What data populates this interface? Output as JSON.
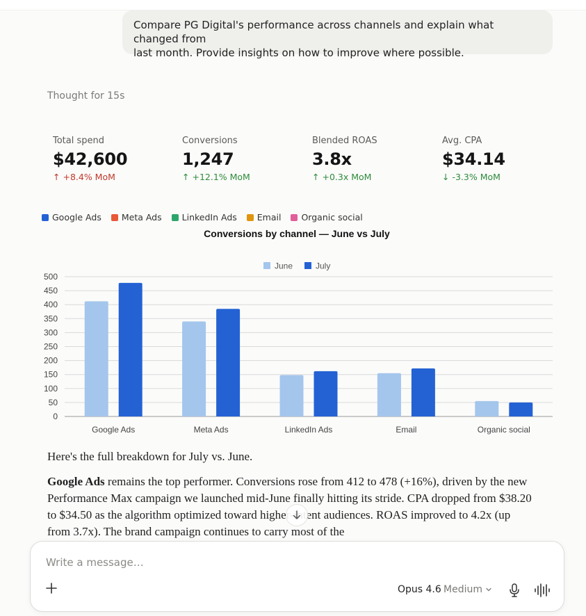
{
  "user_message": {
    "line1": "Compare PG Digital's performance across channels and explain what changed from",
    "line2": "last month. Provide insights on how to improve where possible."
  },
  "thought_label": "Thought for 15s",
  "kpis": [
    {
      "label": "Total spend",
      "value": "$42,600",
      "delta": "+8.4% MoM",
      "direction": "up",
      "color": "#c0392b"
    },
    {
      "label": "Conversions",
      "value": "1,247",
      "delta": "+12.1% MoM",
      "direction": "up",
      "color": "#2e8b3a"
    },
    {
      "label": "Blended ROAS",
      "value": "3.8x",
      "delta": "+0.3x MoM",
      "direction": "up",
      "color": "#2e8b3a"
    },
    {
      "label": "Avg. CPA",
      "value": "$34.14",
      "delta": "-3.3% MoM",
      "direction": "down",
      "color": "#2e8b3a"
    }
  ],
  "channel_legend": [
    {
      "label": "Google Ads",
      "color": "#2462d4"
    },
    {
      "label": "Meta Ads",
      "color": "#e8593a"
    },
    {
      "label": "LinkedIn Ads",
      "color": "#2ea56b"
    },
    {
      "label": "Email",
      "color": "#e0950f"
    },
    {
      "label": "Organic social",
      "color": "#e0609a"
    }
  ],
  "chart_data": {
    "type": "bar",
    "title": "Conversions by channel — June vs July",
    "categories": [
      "Google Ads",
      "Meta Ads",
      "LinkedIn Ads",
      "Email",
      "Organic social"
    ],
    "series": [
      {
        "name": "June",
        "values": [
          412,
          340,
          148,
          155,
          55
        ],
        "color": "#a4c6ec"
      },
      {
        "name": "July",
        "values": [
          478,
          385,
          162,
          172,
          50
        ],
        "color": "#2462d4"
      }
    ],
    "ylim": [
      0,
      500
    ],
    "yticks": [
      0,
      50,
      100,
      150,
      200,
      250,
      300,
      350,
      400,
      450,
      500
    ],
    "grid": true,
    "legend": "top-center",
    "xlabel": "",
    "ylabel": ""
  },
  "prose": {
    "intro": "Here's the full breakdown for July vs. June.",
    "google_heading": "Google Ads",
    "google_text": " remains the top performer. Conversions rose from 412 to 478 (+16%), driven by the new Performance Max campaign we launched mid-June finally hitting its stride. CPA dropped from $38.20 to $34.50 as the algorithm optimized toward higher-intent audiences. ROAS improved to 4.2x (up from 3.7x). The brand campaign continues to carry most of the"
  },
  "composer": {
    "placeholder": "Write a message…",
    "model": "Opus 4.6",
    "effort": "Medium"
  },
  "icons": {
    "plus": "plus-icon",
    "scroll": "arrow-down-icon",
    "mic": "microphone-icon",
    "voice": "voice-waveform-icon",
    "chevron": "chevron-down-icon"
  }
}
